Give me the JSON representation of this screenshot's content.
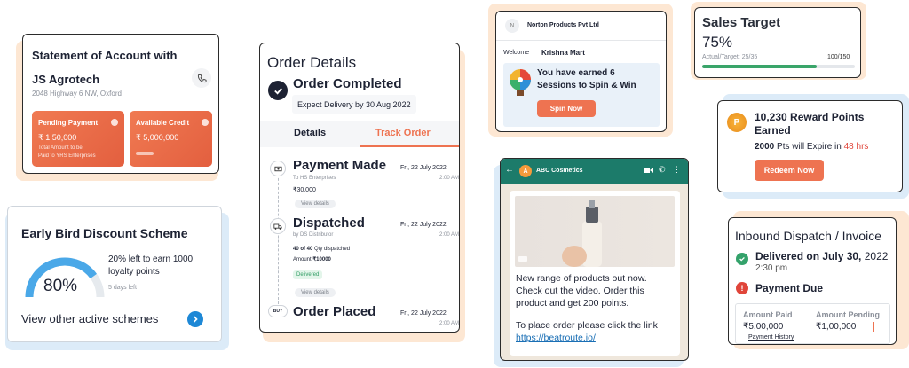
{
  "colors": {
    "accent": "#ee7351",
    "peach": "#fde7d3",
    "blue_bg": "#dcebf8",
    "green": "#34a26b",
    "red": "#e0453a"
  },
  "statement": {
    "title_line1": "Statement of Account with",
    "title_line2": "JS Agrotech",
    "address": "2048 Highway 6 NW, Oxford",
    "phone_icon": "phone-icon",
    "pending": {
      "label": "Pending Payment",
      "amount": "₹ 1,50,000",
      "note_line1": "Total Amount to be",
      "note_line2": "Paid to YRS Enterprises"
    },
    "credit": {
      "label": "Available Credit",
      "amount": "₹ 5,000,000"
    }
  },
  "early_bird": {
    "title": "Early Bird Discount Scheme",
    "percent": "80%",
    "progress": 0.8,
    "desc_line1": "20% left to earn 1000",
    "desc_line2": "loyalty points",
    "days_left": "5 days left",
    "link": "View other active schemes"
  },
  "order": {
    "title": "Order Details",
    "status": "Order Completed",
    "expected": "Expect Delivery by 30 Aug 2022",
    "tabs": [
      "Details",
      "Track Order"
    ],
    "active_tab": 1,
    "steps": {
      "payment": {
        "title": "Payment Made",
        "sub": "To HS Enterprises",
        "amount": "₹30,000",
        "chip": "View details",
        "date": "Fri, 22 July 2022",
        "time": "2:00 AM"
      },
      "dispatched": {
        "title": "Dispatched",
        "sub": "by DS Distributor",
        "qty_bold": "40 of 40",
        "qty_rest": " Qty dispatched",
        "amount_label": "Amount",
        "amount": "₹10000",
        "badge": "Delivered",
        "chip": "View details",
        "date": "Fri, 22 July 2022",
        "time": "2:00 AM"
      },
      "placed": {
        "title": "Order Placed",
        "icon_text": "BUY",
        "date": "Fri, 22 July 2022",
        "time": "2:00 AM"
      }
    }
  },
  "norton": {
    "avatar": "N",
    "company": "Norton Products Pvt Ltd",
    "welcome": "Welcome",
    "user": "Krishna Mart",
    "banner_line1": "You have earned 6",
    "banner_line2": "Sessions to Spin & Win",
    "button": "Spin Now"
  },
  "whatsapp": {
    "avatar": "A",
    "name": "ABC Cosmetics",
    "msg_line1": "New range of products out now.",
    "msg_line2": "Check out the video. Order this",
    "msg_line3": "product and get 200 points.",
    "msg_line4": "To place order please click the link",
    "link": "https://beatroute.io/"
  },
  "sales": {
    "title": "Sales Target",
    "percent": "75%",
    "actual_label": "Actual/Target: 25/35",
    "max_label": "100/150",
    "progress": 0.75
  },
  "reward": {
    "coin": "P",
    "title_line1": "10,230 Reward Points",
    "title_line2": "Earned",
    "expire_prefix": "2000",
    "expire_mid": " Pts will Expire in ",
    "expire_hours": "48 hrs",
    "button": "Redeem Now"
  },
  "inbound": {
    "title": "Inbound Dispatch / Invoice",
    "delivered_bold": "Delivered on July 30,",
    "delivered_year": " 2022",
    "delivered_time": "2:30 pm",
    "payment_due": "Payment Due",
    "amount_paid_label": "Amount Paid",
    "amount_paid": "₹5,00,000",
    "amount_pending_label": "Amount Pending",
    "amount_pending": "₹1,00,000",
    "history": "Payment History"
  }
}
